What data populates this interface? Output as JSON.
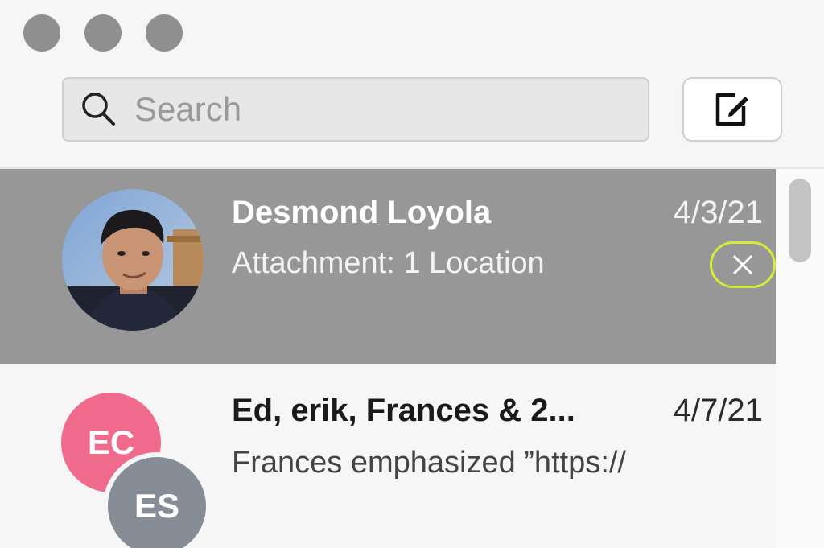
{
  "window": {
    "controls": [
      "close",
      "minimize",
      "zoom"
    ]
  },
  "search": {
    "placeholder": "Search",
    "icon": "magnifying-glass"
  },
  "toolbar": {
    "compose_icon": "compose-pencil-square"
  },
  "conversations": [
    {
      "name": "Desmond Loyola",
      "date": "4/3/21",
      "preview": "Attachment: 1 Location",
      "selected": true,
      "avatar": "photo",
      "delete_icon": "close-x"
    },
    {
      "name": "Ed, erik, Frances & 2...",
      "date": "4/7/21",
      "preview": "Frances emphasized ”https://",
      "selected": false,
      "avatar_initials": [
        "EC",
        "ES"
      ]
    }
  ],
  "colors": {
    "selected_row": "#979797",
    "highlight_ring": "#d5ea3a",
    "avatar_pink": "#f06a8c",
    "avatar_gray": "#878d97"
  }
}
